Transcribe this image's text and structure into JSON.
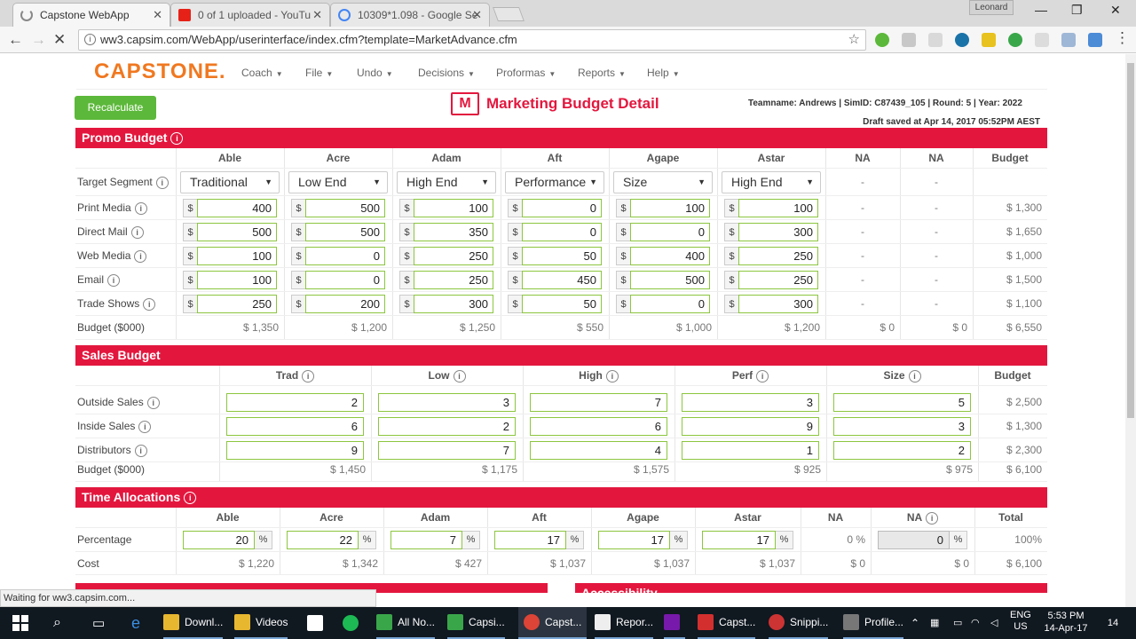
{
  "browser": {
    "tabs": [
      {
        "title": "Capstone WebApp",
        "active": true
      },
      {
        "title": "0 of 1 uploaded - YouTu",
        "active": false
      },
      {
        "title": "10309*1.098 - Google Se",
        "active": false
      }
    ],
    "user": "Leonard",
    "url": "ww3.capsim.com/WebApp/userinterface/index.cfm?template=MarketAdvance.cfm",
    "status": "Waiting for ww3.capsim.com..."
  },
  "app": {
    "logo": "CAPSTONE.",
    "menu": [
      "Coach",
      "File",
      "Undo",
      "Decisions",
      "Proformas",
      "Reports",
      "Help"
    ],
    "recalculate": "Recalculate",
    "title": "Marketing Budget Detail",
    "teaminfo": "Teamname: Andrews | SimID: C87439_105 | Round: 5 | Year: 2022",
    "draft": "Draft saved at Apr 14, 2017 05:52PM AEST"
  },
  "promo": {
    "header": "Promo Budget",
    "columns": [
      "Able",
      "Acre",
      "Adam",
      "Aft",
      "Agape",
      "Astar",
      "NA",
      "NA",
      "Budget"
    ],
    "segment_label": "Target Segment",
    "segments": [
      "Traditional",
      "Low End",
      "High End",
      "Performance",
      "Size",
      "High End"
    ],
    "dash": "-",
    "rows": [
      {
        "label": "Print Media",
        "values": [
          "400",
          "500",
          "100",
          "0",
          "100",
          "100"
        ],
        "budget": "$ 1,300"
      },
      {
        "label": "Direct Mail",
        "values": [
          "500",
          "500",
          "350",
          "0",
          "0",
          "300"
        ],
        "budget": "$ 1,650"
      },
      {
        "label": "Web Media",
        "values": [
          "100",
          "0",
          "250",
          "50",
          "400",
          "250"
        ],
        "budget": "$ 1,000"
      },
      {
        "label": "Email",
        "values": [
          "100",
          "0",
          "250",
          "450",
          "500",
          "250"
        ],
        "budget": "$ 1,500"
      },
      {
        "label": "Trade Shows",
        "values": [
          "250",
          "200",
          "300",
          "50",
          "0",
          "300"
        ],
        "budget": "$ 1,100"
      }
    ],
    "totals_label": "Budget ($000)",
    "totals": [
      "$ 1,350",
      "$ 1,200",
      "$ 1,250",
      "$ 550",
      "$ 1,000",
      "$ 1,200",
      "$ 0",
      "$ 0",
      "$ 6,550"
    ]
  },
  "sales": {
    "header": "Sales Budget",
    "columns": [
      "Trad",
      "Low",
      "High",
      "Perf",
      "Size",
      "Budget"
    ],
    "rows": [
      {
        "label": "Outside Sales",
        "values": [
          "2",
          "3",
          "7",
          "3",
          "5"
        ],
        "budget": "$ 2,500"
      },
      {
        "label": "Inside Sales",
        "values": [
          "6",
          "2",
          "6",
          "9",
          "3"
        ],
        "budget": "$ 1,300"
      },
      {
        "label": "Distributors",
        "values": [
          "9",
          "7",
          "4",
          "1",
          "2"
        ],
        "budget": "$ 2,300"
      }
    ],
    "totals_label": "Budget ($000)",
    "totals": [
      "$ 1,450",
      "$ 1,175",
      "$ 1,575",
      "$ 925",
      "$ 975",
      "$ 6,100"
    ]
  },
  "time": {
    "header": "Time Allocations",
    "columns": [
      "Able",
      "Acre",
      "Adam",
      "Aft",
      "Agape",
      "Astar",
      "NA",
      "NA",
      "Total"
    ],
    "pct_label": "Percentage",
    "pct": [
      "20",
      "22",
      "7",
      "17",
      "17",
      "17"
    ],
    "pct_na1": "0 %",
    "pct_na2": "0",
    "pct_total": "100%",
    "pct_unit": "%",
    "cost_label": "Cost",
    "cost": [
      "$ 1,220",
      "$ 1,342",
      "$ 427",
      "$ 1,037",
      "$ 1,037",
      "$ 1,037",
      "$ 0",
      "$ 0",
      "$ 6,100"
    ]
  },
  "accessibility": "Accessibility",
  "taskbar": {
    "items": [
      "Downl...",
      "Videos",
      "All No...",
      "Capsi...",
      "Capst...",
      "Repor...",
      "Capst...",
      "Snippi...",
      "Profile..."
    ],
    "lang1": "ENG",
    "lang2": "US",
    "time": "5:53 PM",
    "date": "14-Apr-17",
    "notif": "14"
  }
}
